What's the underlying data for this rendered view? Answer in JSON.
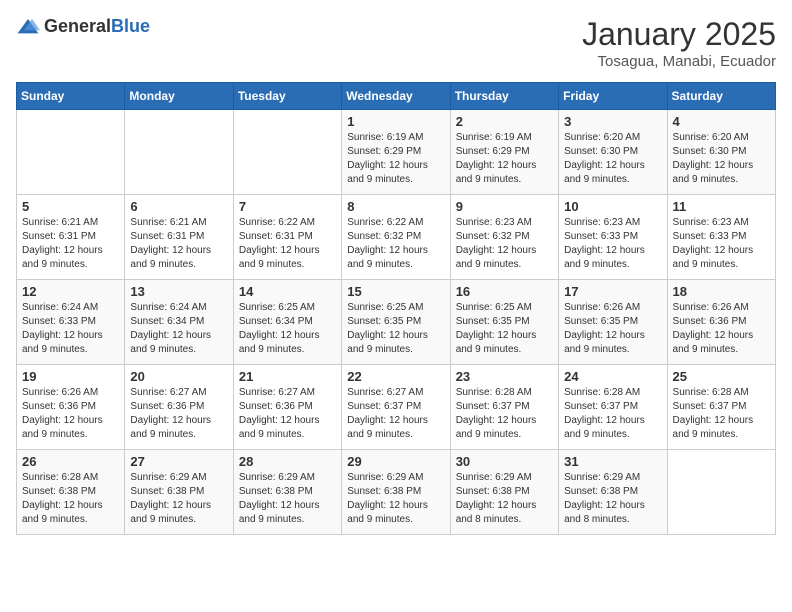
{
  "logo": {
    "text_general": "General",
    "text_blue": "Blue"
  },
  "title": "January 2025",
  "location": "Tosagua, Manabi, Ecuador",
  "days_of_week": [
    "Sunday",
    "Monday",
    "Tuesday",
    "Wednesday",
    "Thursday",
    "Friday",
    "Saturday"
  ],
  "weeks": [
    [
      {
        "day": "",
        "sunrise": "",
        "sunset": "",
        "daylight": ""
      },
      {
        "day": "",
        "sunrise": "",
        "sunset": "",
        "daylight": ""
      },
      {
        "day": "",
        "sunrise": "",
        "sunset": "",
        "daylight": ""
      },
      {
        "day": "1",
        "sunrise": "Sunrise: 6:19 AM",
        "sunset": "Sunset: 6:29 PM",
        "daylight": "Daylight: 12 hours and 9 minutes."
      },
      {
        "day": "2",
        "sunrise": "Sunrise: 6:19 AM",
        "sunset": "Sunset: 6:29 PM",
        "daylight": "Daylight: 12 hours and 9 minutes."
      },
      {
        "day": "3",
        "sunrise": "Sunrise: 6:20 AM",
        "sunset": "Sunset: 6:30 PM",
        "daylight": "Daylight: 12 hours and 9 minutes."
      },
      {
        "day": "4",
        "sunrise": "Sunrise: 6:20 AM",
        "sunset": "Sunset: 6:30 PM",
        "daylight": "Daylight: 12 hours and 9 minutes."
      }
    ],
    [
      {
        "day": "5",
        "sunrise": "Sunrise: 6:21 AM",
        "sunset": "Sunset: 6:31 PM",
        "daylight": "Daylight: 12 hours and 9 minutes."
      },
      {
        "day": "6",
        "sunrise": "Sunrise: 6:21 AM",
        "sunset": "Sunset: 6:31 PM",
        "daylight": "Daylight: 12 hours and 9 minutes."
      },
      {
        "day": "7",
        "sunrise": "Sunrise: 6:22 AM",
        "sunset": "Sunset: 6:31 PM",
        "daylight": "Daylight: 12 hours and 9 minutes."
      },
      {
        "day": "8",
        "sunrise": "Sunrise: 6:22 AM",
        "sunset": "Sunset: 6:32 PM",
        "daylight": "Daylight: 12 hours and 9 minutes."
      },
      {
        "day": "9",
        "sunrise": "Sunrise: 6:23 AM",
        "sunset": "Sunset: 6:32 PM",
        "daylight": "Daylight: 12 hours and 9 minutes."
      },
      {
        "day": "10",
        "sunrise": "Sunrise: 6:23 AM",
        "sunset": "Sunset: 6:33 PM",
        "daylight": "Daylight: 12 hours and 9 minutes."
      },
      {
        "day": "11",
        "sunrise": "Sunrise: 6:23 AM",
        "sunset": "Sunset: 6:33 PM",
        "daylight": "Daylight: 12 hours and 9 minutes."
      }
    ],
    [
      {
        "day": "12",
        "sunrise": "Sunrise: 6:24 AM",
        "sunset": "Sunset: 6:33 PM",
        "daylight": "Daylight: 12 hours and 9 minutes."
      },
      {
        "day": "13",
        "sunrise": "Sunrise: 6:24 AM",
        "sunset": "Sunset: 6:34 PM",
        "daylight": "Daylight: 12 hours and 9 minutes."
      },
      {
        "day": "14",
        "sunrise": "Sunrise: 6:25 AM",
        "sunset": "Sunset: 6:34 PM",
        "daylight": "Daylight: 12 hours and 9 minutes."
      },
      {
        "day": "15",
        "sunrise": "Sunrise: 6:25 AM",
        "sunset": "Sunset: 6:35 PM",
        "daylight": "Daylight: 12 hours and 9 minutes."
      },
      {
        "day": "16",
        "sunrise": "Sunrise: 6:25 AM",
        "sunset": "Sunset: 6:35 PM",
        "daylight": "Daylight: 12 hours and 9 minutes."
      },
      {
        "day": "17",
        "sunrise": "Sunrise: 6:26 AM",
        "sunset": "Sunset: 6:35 PM",
        "daylight": "Daylight: 12 hours and 9 minutes."
      },
      {
        "day": "18",
        "sunrise": "Sunrise: 6:26 AM",
        "sunset": "Sunset: 6:36 PM",
        "daylight": "Daylight: 12 hours and 9 minutes."
      }
    ],
    [
      {
        "day": "19",
        "sunrise": "Sunrise: 6:26 AM",
        "sunset": "Sunset: 6:36 PM",
        "daylight": "Daylight: 12 hours and 9 minutes."
      },
      {
        "day": "20",
        "sunrise": "Sunrise: 6:27 AM",
        "sunset": "Sunset: 6:36 PM",
        "daylight": "Daylight: 12 hours and 9 minutes."
      },
      {
        "day": "21",
        "sunrise": "Sunrise: 6:27 AM",
        "sunset": "Sunset: 6:36 PM",
        "daylight": "Daylight: 12 hours and 9 minutes."
      },
      {
        "day": "22",
        "sunrise": "Sunrise: 6:27 AM",
        "sunset": "Sunset: 6:37 PM",
        "daylight": "Daylight: 12 hours and 9 minutes."
      },
      {
        "day": "23",
        "sunrise": "Sunrise: 6:28 AM",
        "sunset": "Sunset: 6:37 PM",
        "daylight": "Daylight: 12 hours and 9 minutes."
      },
      {
        "day": "24",
        "sunrise": "Sunrise: 6:28 AM",
        "sunset": "Sunset: 6:37 PM",
        "daylight": "Daylight: 12 hours and 9 minutes."
      },
      {
        "day": "25",
        "sunrise": "Sunrise: 6:28 AM",
        "sunset": "Sunset: 6:37 PM",
        "daylight": "Daylight: 12 hours and 9 minutes."
      }
    ],
    [
      {
        "day": "26",
        "sunrise": "Sunrise: 6:28 AM",
        "sunset": "Sunset: 6:38 PM",
        "daylight": "Daylight: 12 hours and 9 minutes."
      },
      {
        "day": "27",
        "sunrise": "Sunrise: 6:29 AM",
        "sunset": "Sunset: 6:38 PM",
        "daylight": "Daylight: 12 hours and 9 minutes."
      },
      {
        "day": "28",
        "sunrise": "Sunrise: 6:29 AM",
        "sunset": "Sunset: 6:38 PM",
        "daylight": "Daylight: 12 hours and 9 minutes."
      },
      {
        "day": "29",
        "sunrise": "Sunrise: 6:29 AM",
        "sunset": "Sunset: 6:38 PM",
        "daylight": "Daylight: 12 hours and 9 minutes."
      },
      {
        "day": "30",
        "sunrise": "Sunrise: 6:29 AM",
        "sunset": "Sunset: 6:38 PM",
        "daylight": "Daylight: 12 hours and 8 minutes."
      },
      {
        "day": "31",
        "sunrise": "Sunrise: 6:29 AM",
        "sunset": "Sunset: 6:38 PM",
        "daylight": "Daylight: 12 hours and 8 minutes."
      },
      {
        "day": "",
        "sunrise": "",
        "sunset": "",
        "daylight": ""
      }
    ]
  ]
}
